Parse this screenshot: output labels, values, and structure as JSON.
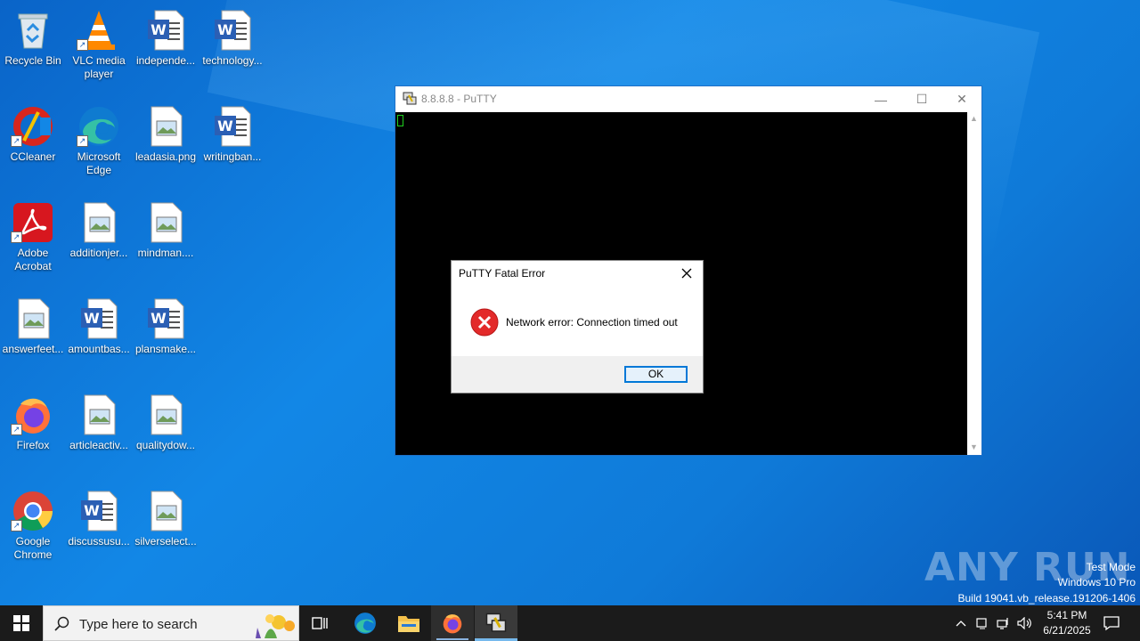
{
  "desktop_icons": [
    {
      "label": "Recycle Bin",
      "icon": "recycle-bin-icon"
    },
    {
      "label": "VLC media player",
      "icon": "vlc-icon"
    },
    {
      "label": "independe...",
      "icon": "word-document-icon"
    },
    {
      "label": "technology...",
      "icon": "word-document-icon"
    },
    {
      "label": "CCleaner",
      "icon": "ccleaner-icon"
    },
    {
      "label": "Microsoft Edge",
      "icon": "edge-icon"
    },
    {
      "label": "leadasia.png",
      "icon": "image-file-icon"
    },
    {
      "label": "writingban...",
      "icon": "word-document-icon"
    },
    {
      "label": "Adobe Acrobat",
      "icon": "acrobat-icon"
    },
    {
      "label": "additionjer...",
      "icon": "image-file-icon"
    },
    {
      "label": "mindman....",
      "icon": "image-file-icon"
    },
    {
      "label": "answerfeet...",
      "icon": "image-file-icon"
    },
    {
      "label": "amountbas...",
      "icon": "word-document-icon"
    },
    {
      "label": "plansmake...",
      "icon": "word-document-icon"
    },
    {
      "label": "Firefox",
      "icon": "firefox-icon"
    },
    {
      "label": "articleactiv...",
      "icon": "image-file-icon"
    },
    {
      "label": "qualitydow...",
      "icon": "image-file-icon"
    },
    {
      "label": "Google Chrome",
      "icon": "chrome-icon"
    },
    {
      "label": "discussusu...",
      "icon": "word-document-icon"
    },
    {
      "label": "silverselect...",
      "icon": "image-file-icon"
    }
  ],
  "putty_window": {
    "title": "8.8.8.8 - PuTTY",
    "minimize": "—",
    "maximize": "☐",
    "close": "✕"
  },
  "error_dialog": {
    "title": "PuTTY Fatal Error",
    "message": "Network error: Connection timed out",
    "ok_label": "OK",
    "close": "✕"
  },
  "watermark": {
    "brand": "ANY RUN",
    "line1": "Test Mode",
    "line2": "Windows 10 Pro",
    "line3": "Build 19041.vb_release.191206-1406"
  },
  "taskbar": {
    "search_placeholder": "Type here to search",
    "time": "5:41 PM",
    "date": "6/21/2025",
    "colors": {
      "background": "#1b1b1b",
      "accent": "#0078d7"
    }
  }
}
